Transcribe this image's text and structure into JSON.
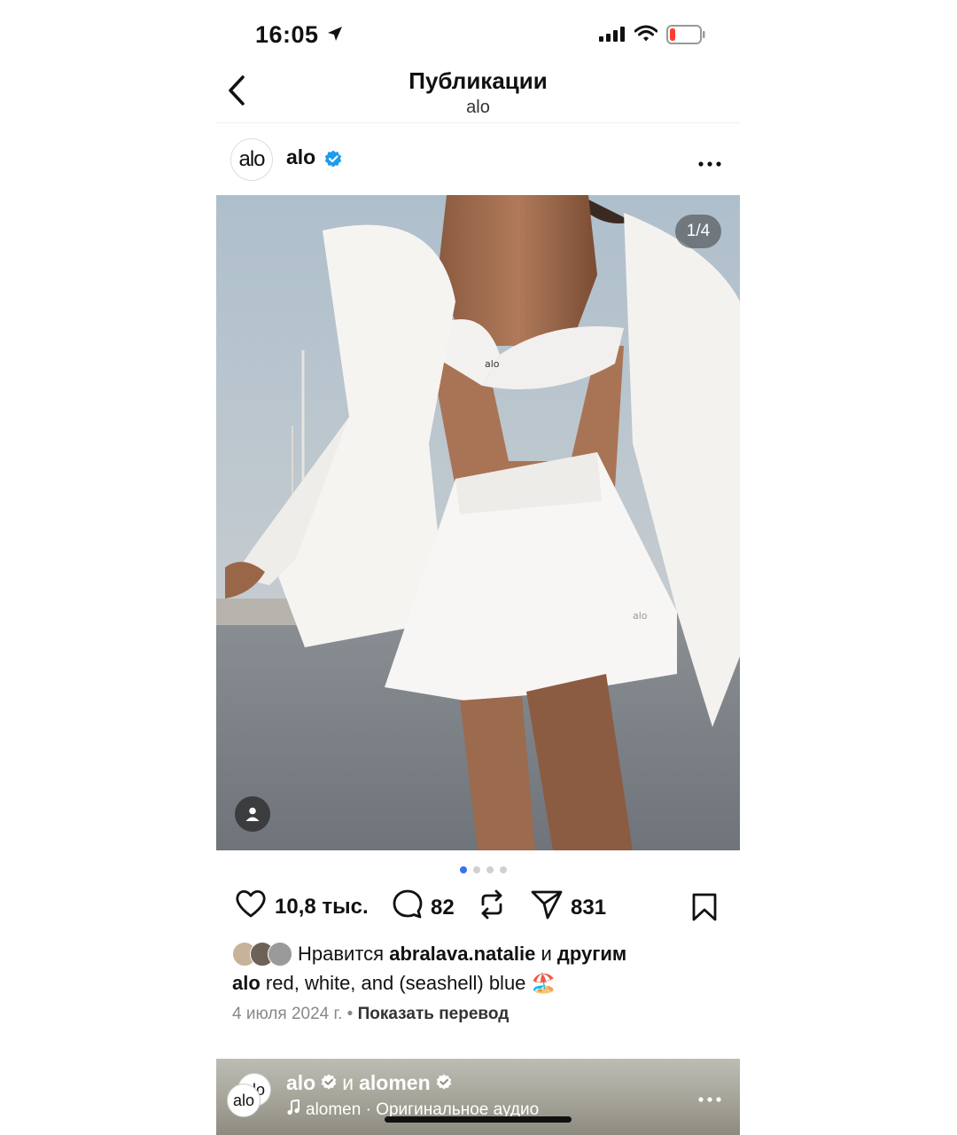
{
  "status_bar": {
    "time": "16:05"
  },
  "nav": {
    "title": "Публикации",
    "subtitle": "alo"
  },
  "post": {
    "avatar_text": "alo",
    "username": "alo",
    "photo_counter": "1/4",
    "slides_total": 4,
    "slide_active": 1,
    "likes_count": "10,8 тыс.",
    "comments_count": "82",
    "shares_count": "831",
    "liked_by": {
      "prefix": "Нравится",
      "user": "abralava.natalie",
      "joiner": "и",
      "others": "другим"
    },
    "caption_user": "alo",
    "caption_text": "red, white, and (seashell) blue 🏖️",
    "date": "4 июля 2024 г.",
    "separator": "•",
    "translate": "Показать перевод"
  },
  "next_post": {
    "avatar_text": "alo",
    "user1": "alo",
    "joiner": "и",
    "user2": "alomen",
    "audio": "alomen · Оригинальное аудио"
  },
  "colors": {
    "accent": "#3a6ff7",
    "verified": "#1d9bf0",
    "battery_low": "#ff3b30"
  },
  "icons": [
    "location-arrow-icon",
    "signal-icon",
    "wifi-icon",
    "battery-icon",
    "back-chevron-icon",
    "verified-badge-icon",
    "more-icon",
    "tag-person-icon",
    "heart-icon",
    "comment-icon",
    "repost-icon",
    "share-icon",
    "bookmark-icon",
    "music-note-icon"
  ]
}
